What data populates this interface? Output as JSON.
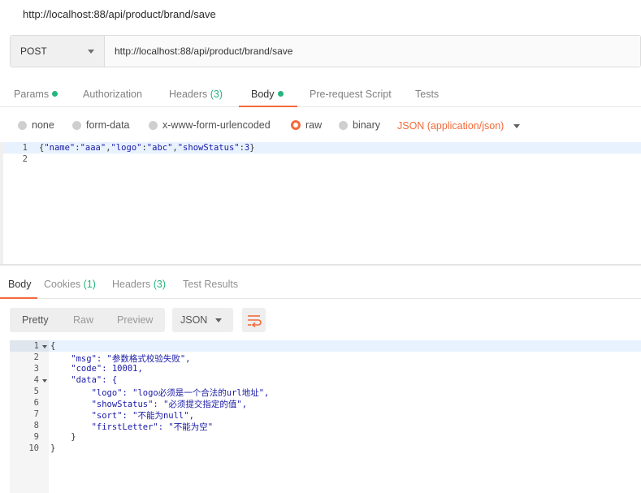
{
  "request": {
    "title": "http://localhost:88/api/product/brand/save",
    "method": "POST",
    "url": "http://localhost:88/api/product/brand/save"
  },
  "request_tabs": {
    "params": "Params",
    "authorization": "Authorization",
    "headers": "Headers",
    "headers_count": "(3)",
    "body": "Body",
    "prerequest": "Pre-request Script",
    "tests": "Tests",
    "active": "Body"
  },
  "body_options": {
    "none": "none",
    "form_data": "form-data",
    "urlencoded": "x-www-form-urlencoded",
    "raw": "raw",
    "binary": "binary",
    "selected": "raw",
    "content_type": "JSON (application/json)"
  },
  "request_body": {
    "line_numbers": [
      "1",
      "2"
    ],
    "open": "{",
    "k1": "\"name\"",
    "v1": "\"aaa\"",
    "k2": "\"logo\"",
    "v2": "\"abc\"",
    "k3": "\"showStatus\"",
    "v3": "3",
    "close": "}"
  },
  "response_tabs": {
    "body": "Body",
    "cookies": "Cookies",
    "cookies_count": "(1)",
    "headers": "Headers",
    "headers_count": "(3)",
    "test_results": "Test Results",
    "active": "Body"
  },
  "response_toolbar": {
    "pretty": "Pretty",
    "raw": "Raw",
    "preview": "Preview",
    "format": "JSON"
  },
  "response_body": {
    "line_numbers": [
      "1",
      "2",
      "3",
      "4",
      "5",
      "6",
      "7",
      "8",
      "9",
      "10"
    ],
    "lines": [
      "{",
      "    \"msg\": \"参数格式校验失败\",",
      "    \"code\": 10001,",
      "    \"data\": {",
      "        \"logo\": \"logo必须是一个合法的url地址\",",
      "        \"showStatus\": \"必须提交指定的值\",",
      "        \"sort\": \"不能为null\",",
      "        \"firstLetter\": \"不能为空\"",
      "    }",
      "}"
    ]
  },
  "colors": {
    "accent": "#f26b3a",
    "status_dot": "#26b47f",
    "code_blue": "#1a1aa6",
    "line_highlight": "#e8f2fe"
  }
}
